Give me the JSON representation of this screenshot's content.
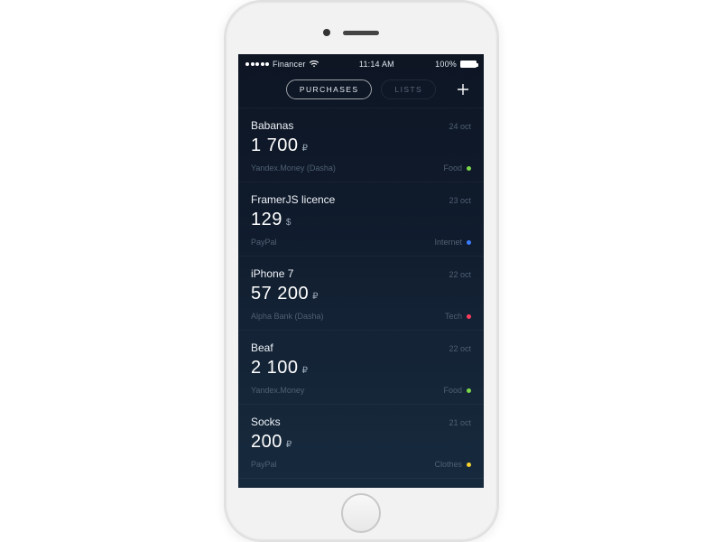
{
  "status": {
    "carrier": "Financer",
    "time": "11:14 AM",
    "battery": "100%"
  },
  "header": {
    "tabs": {
      "purchases": "PURCHASES",
      "lists": "LISTS"
    },
    "add_icon": "plus-icon"
  },
  "categories": {
    "food": {
      "label": "Food",
      "color": "#7bd94a"
    },
    "internet": {
      "label": "Internet",
      "color": "#3b7bff"
    },
    "tech": {
      "label": "Tech",
      "color": "#ff3b5c"
    },
    "clothes": {
      "label": "Clothes",
      "color": "#f5d22e"
    }
  },
  "purchases": [
    {
      "title": "Babanas",
      "date": "24 oct",
      "amount": "1 700",
      "currency": "₽",
      "source": "Yandex.Money (Dasha)",
      "category": "food"
    },
    {
      "title": "FramerJS licence",
      "date": "23 oct",
      "amount": "129",
      "currency": "$",
      "source": "PayPal",
      "category": "internet"
    },
    {
      "title": "iPhone 7",
      "date": "22 oct",
      "amount": "57 200",
      "currency": "₽",
      "source": "Alpha Bank (Dasha)",
      "category": "tech"
    },
    {
      "title": "Beaf",
      "date": "22 oct",
      "amount": "2 100",
      "currency": "₽",
      "source": "Yandex.Money",
      "category": "food"
    },
    {
      "title": "Socks",
      "date": "21 oct",
      "amount": "200",
      "currency": "₽",
      "source": "PayPal",
      "category": "clothes"
    }
  ]
}
